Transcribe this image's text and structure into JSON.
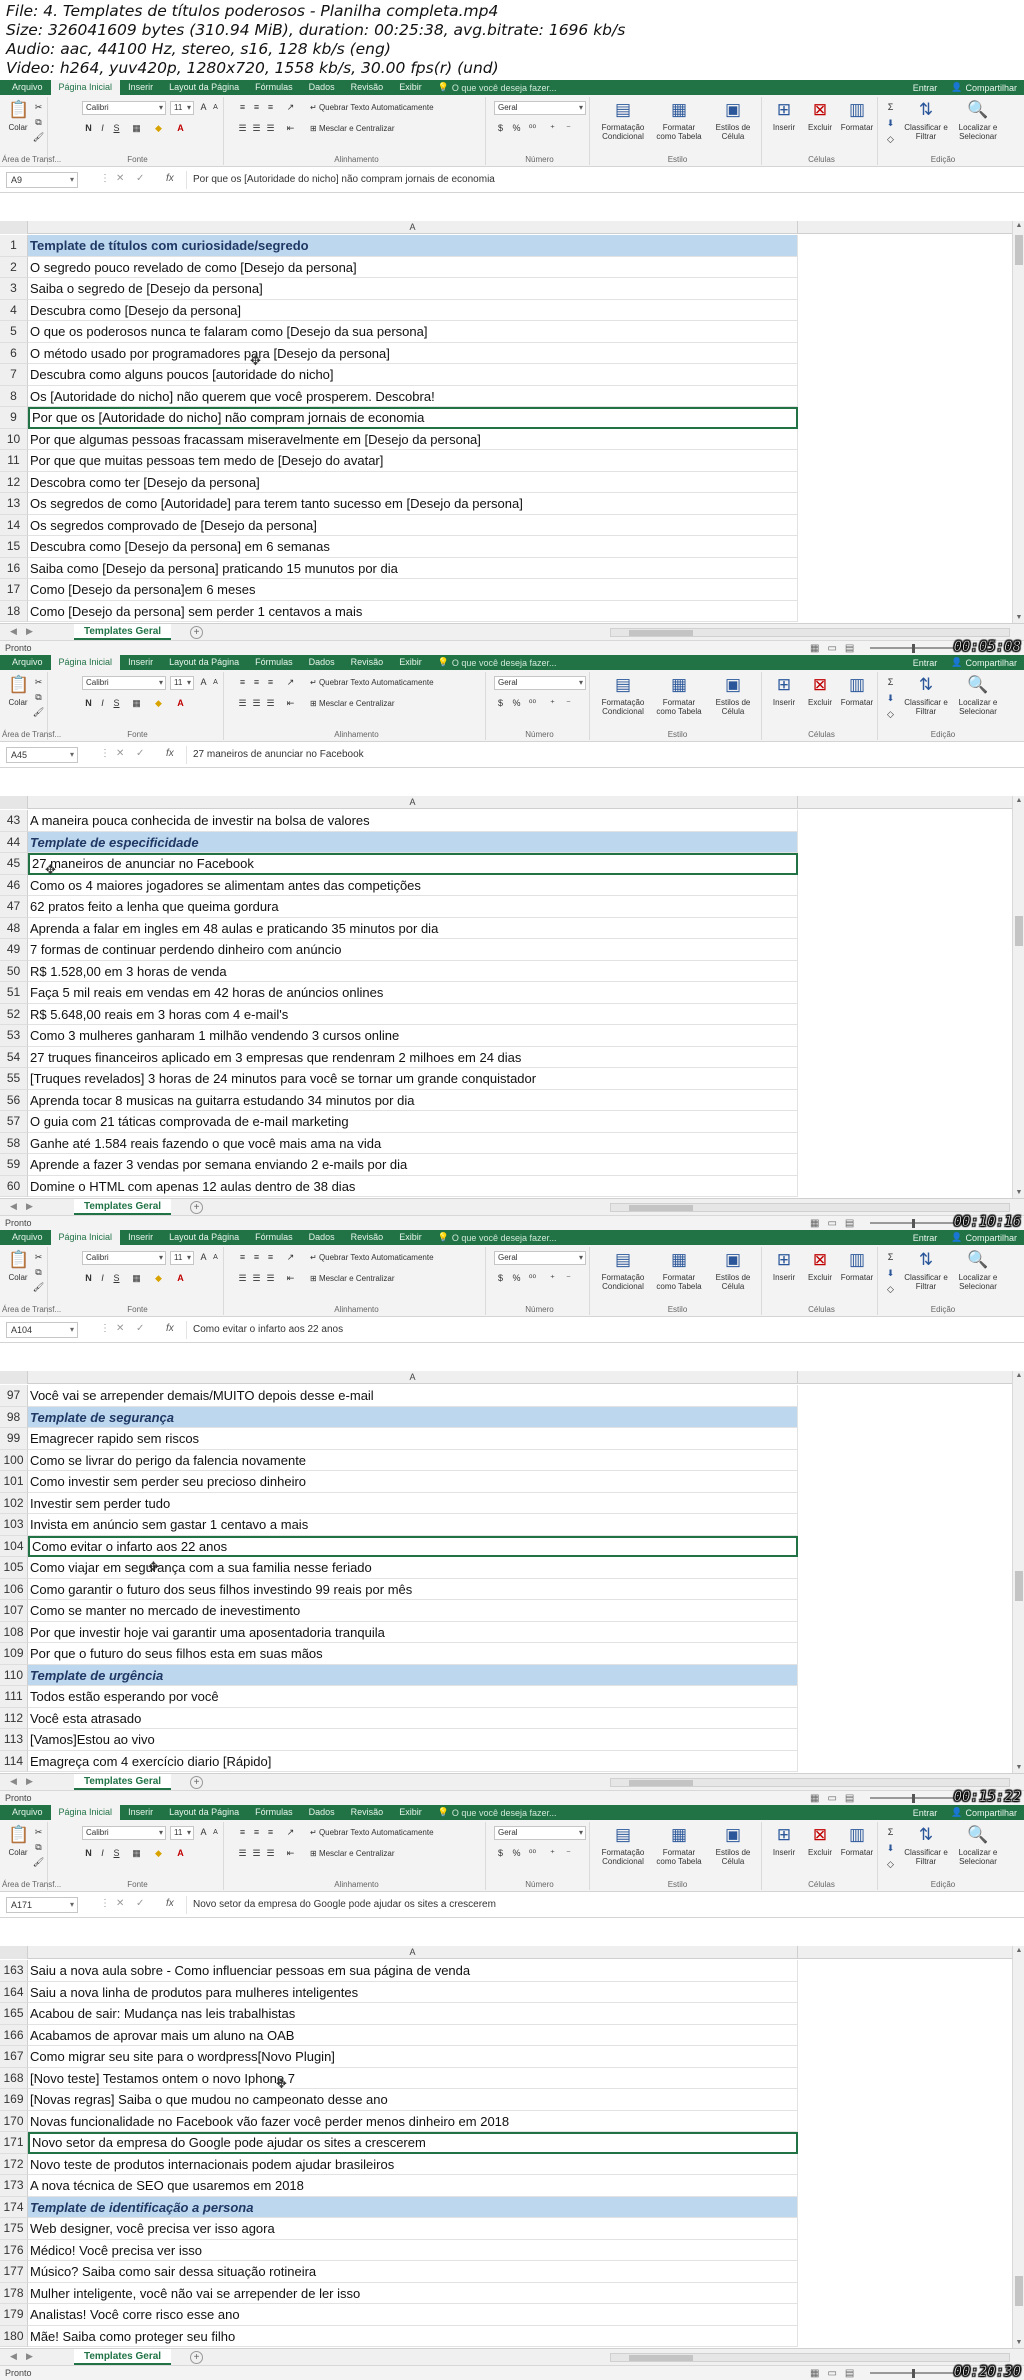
{
  "info": {
    "line1": "File: 4. Templates de títulos poderosos - Planilha completa.mp4",
    "line2": "Size: 326041609 bytes (310.94 MiB), duration: 00:25:38, avg.bitrate: 1696 kb/s",
    "line3": "Audio: aac, 44100 Hz, stereo, s16, 128 kb/s (eng)",
    "line4": "Video: h264, yuv420p, 1280x720, 1558 kb/s, 30.00 fps(r) (und)"
  },
  "ribbon": {
    "tabs": [
      "Arquivo",
      "Página Inicial",
      "Inserir",
      "Layout da Página",
      "Fórmulas",
      "Dados",
      "Revisão",
      "Exibir"
    ],
    "tell_me": "O que você deseja fazer...",
    "signin": "Entrar",
    "share": "Compartilhar",
    "font_name": "Calibri",
    "font_size": "11",
    "wrap_text": "Quebrar Texto Automaticamente",
    "merge_center": "Mesclar e Centralizar",
    "number_format": "Geral",
    "paste": "Colar",
    "group_clipboard": "Área de Transf...",
    "group_font": "Fonte",
    "group_alignment": "Alinhamento",
    "group_number": "Número",
    "group_styles": "Estilo",
    "group_cells": "Células",
    "group_editing": "Edição",
    "cond_format": "Formatação Condicional",
    "format_table": "Formatar como Tabela",
    "cell_styles": "Estilos de Célula",
    "insert": "Inserir",
    "delete": "Excluir",
    "format": "Formatar",
    "sort_filter": "Classificar e Filtrar",
    "find_select": "Localizar e Selecionar",
    "col_header": "A"
  },
  "status": {
    "ready": "Pronto",
    "sheet_tab": "Templates Geral"
  },
  "panels": [
    {
      "name_box": "A9",
      "formula": "Por que os [Autoridade do nicho] não compram jornais de economia",
      "timestamp": "00:05:08",
      "rows": [
        {
          "n": "1",
          "text": "Template de títulos com curiosidade/segredo",
          "heading": true
        },
        {
          "n": "2",
          "text": "O segredo pouco revelado de como [Desejo da persona]"
        },
        {
          "n": "3",
          "text": "Saiba o segredo de [Desejo da persona]"
        },
        {
          "n": "4",
          "text": "Descubra como [Desejo da persona]"
        },
        {
          "n": "5",
          "text": "O que os poderosos nunca te falaram como [Desejo da sua persona]"
        },
        {
          "n": "6",
          "text": "O método usado por programadores para [Desejo da persona]"
        },
        {
          "n": "7",
          "text": "Descubra como alguns poucos [autoridade do nicho]"
        },
        {
          "n": "8",
          "text": "Os [Autoridade do nicho] não querem que você prosperem. Descobra!"
        },
        {
          "n": "9",
          "text": "Por que os [Autoridade do nicho] não compram jornais de economia",
          "selected": true
        },
        {
          "n": "10",
          "text": "Por que algumas pessoas fracassam miseravelmente em [Desejo da persona]"
        },
        {
          "n": "11",
          "text": "Por que que muitas pessoas tem medo de [Desejo do avatar]"
        },
        {
          "n": "12",
          "text": "Descobra como ter [Desejo da persona]"
        },
        {
          "n": "13",
          "text": "Os segredos de como [Autoridade] para terem tanto sucesso em [Desejo da persona]"
        },
        {
          "n": "14",
          "text": "Os segredos comprovado de [Desejo da persona]"
        },
        {
          "n": "15",
          "text": "Descubra como [Desejo da persona] em 6 semanas"
        },
        {
          "n": "16",
          "text": "Saiba como [Desejo da persona] praticando 15 munutos por dia"
        },
        {
          "n": "17",
          "text": "Como [Desejo da persona]em 6 meses"
        },
        {
          "n": "18",
          "text": "Como [Desejo da persona] sem perder 1 centavos a mais"
        }
      ]
    },
    {
      "name_box": "A45",
      "formula": "27 maneiros de anunciar no Facebook",
      "timestamp": "00:10:16",
      "rows": [
        {
          "n": "43",
          "text": "A maneira pouca conhecida de investir na bolsa de valores"
        },
        {
          "n": "44",
          "text": "Template de especificidade",
          "heading": true,
          "italic": true
        },
        {
          "n": "45",
          "text": "27 maneiros de anunciar no Facebook",
          "selected": true
        },
        {
          "n": "46",
          "text": "Como os  4 maiores jogadores se alimentam antes das competições"
        },
        {
          "n": "47",
          "text": "62 pratos feito a lenha que queima gordura"
        },
        {
          "n": "48",
          "text": "Aprenda a falar em ingles em 48 aulas e praticando 35 minutos por dia"
        },
        {
          "n": "49",
          "text": "7 formas de continuar perdendo dinheiro com anúncio"
        },
        {
          "n": "50",
          "text": "R$ 1.528,00 em 3 horas de venda"
        },
        {
          "n": "51",
          "text": "Faça 5 mil reais em vendas em 42 horas de anúncios onlines"
        },
        {
          "n": "52",
          "text": "R$ 5.648,00 reais em 3 horas com 4 e-mail's"
        },
        {
          "n": "53",
          "text": "Como 3 mulheres ganharam 1 milhão vendendo 3 cursos online"
        },
        {
          "n": "54",
          "text": "27 truques financeiros aplicado em 3 empresas que rendenram 2 milhoes em 24 dias"
        },
        {
          "n": "55",
          "text": "[Truques revelados] 3 horas de 24 minutos para você se tornar um grande conquistador"
        },
        {
          "n": "56",
          "text": "Aprenda tocar 8 musicas na guitarra estudando 34 minutos por dia"
        },
        {
          "n": "57",
          "text": "O guia com 21 táticas comprovada de e-mail marketing"
        },
        {
          "n": "58",
          "text": "Ganhe até 1.584 reais fazendo o que você mais ama na vida"
        },
        {
          "n": "59",
          "text": "Aprende a fazer 3 vendas por semana enviando 2 e-mails por dia"
        },
        {
          "n": "60",
          "text": "Domine o HTML com apenas 12 aulas dentro de 38 dias"
        }
      ]
    },
    {
      "name_box": "A104",
      "formula": "Como evitar o infarto aos 22 anos",
      "timestamp": "00:15:22",
      "rows": [
        {
          "n": "97",
          "text": "Você vai se arrepender demais/MUITO depois desse e-mail"
        },
        {
          "n": "98",
          "text": "Template de segurança",
          "heading": true,
          "italic": true
        },
        {
          "n": "99",
          "text": "Emagrecer rapido sem riscos"
        },
        {
          "n": "100",
          "text": "Como se livrar do perigo da falencia novamente"
        },
        {
          "n": "101",
          "text": "Como investir sem perder seu precioso dinheiro"
        },
        {
          "n": "102",
          "text": "Investir sem perder tudo"
        },
        {
          "n": "103",
          "text": "Invista em anúncio sem gastar 1 centavo a mais"
        },
        {
          "n": "104",
          "text": "Como evitar o infarto aos 22 anos",
          "selected": true
        },
        {
          "n": "105",
          "text": "Como viajar em segurança com a sua familia nesse feriado"
        },
        {
          "n": "106",
          "text": "Como garantir o futuro dos seus filhos investindo 99 reais por mês"
        },
        {
          "n": "107",
          "text": "Como se manter no mercado de inevestimento"
        },
        {
          "n": "108",
          "text": "Por que investir hoje vai garantir uma aposentadoria tranquila"
        },
        {
          "n": "109",
          "text": "Por que o futuro do seus filhos esta em suas mãos"
        },
        {
          "n": "110",
          "text": "Template de urgência",
          "heading": true,
          "italic": true
        },
        {
          "n": "111",
          "text": "Todos estão esperando por você"
        },
        {
          "n": "112",
          "text": "Você esta atrasado"
        },
        {
          "n": "113",
          "text": "[Vamos]Estou ao vivo"
        },
        {
          "n": "114",
          "text": "Emagreça com 4 exercício diario [Rápido]"
        }
      ]
    },
    {
      "name_box": "A171",
      "formula": "Novo setor da empresa do Google pode ajudar os sites a crescerem",
      "timestamp": "00:20:30",
      "rows": [
        {
          "n": "163",
          "text": "Saiu a nova aula sobre - Como influenciar pessoas em sua página de venda"
        },
        {
          "n": "164",
          "text": "Saiu a nova linha de produtos para mulheres inteligentes"
        },
        {
          "n": "165",
          "text": "Acabou de sair: Mudança nas leis trabalhistas"
        },
        {
          "n": "166",
          "text": "Acabamos de aprovar mais um aluno na OAB"
        },
        {
          "n": "167",
          "text": "Como migrar seu site para o wordpress[Novo Plugin]"
        },
        {
          "n": "168",
          "text": "[Novo teste] Testamos ontem o novo Iphone 7"
        },
        {
          "n": "169",
          "text": "[Novas regras] Saiba o que mudou no campeonato desse ano"
        },
        {
          "n": "170",
          "text": "Novas funcionalidade no Facebook vão fazer você perder menos dinheiro em 2018"
        },
        {
          "n": "171",
          "text": "Novo setor da empresa do Google pode ajudar os sites a crescerem",
          "selected": true
        },
        {
          "n": "172",
          "text": "Novo teste de produtos internacionais podem ajudar brasileiros"
        },
        {
          "n": "173",
          "text": "A nova técnica de SEO que usaremos em 2018"
        },
        {
          "n": "174",
          "text": "Template de identificação a persona",
          "heading": true,
          "italic": true
        },
        {
          "n": "175",
          "text": "Web designer, você precisa ver isso agora"
        },
        {
          "n": "176",
          "text": "Médico! Você precisa ver isso"
        },
        {
          "n": "177",
          "text": "Músico? Saiba como sair dessa situação rotineira"
        },
        {
          "n": "178",
          "text": "Mulher inteligente, você não vai se arrepender de ler isso"
        },
        {
          "n": "179",
          "text": "Analistas! Você corre risco esse ano"
        },
        {
          "n": "180",
          "text": "Mãe! Saiba como proteger seu filho"
        }
      ]
    }
  ]
}
